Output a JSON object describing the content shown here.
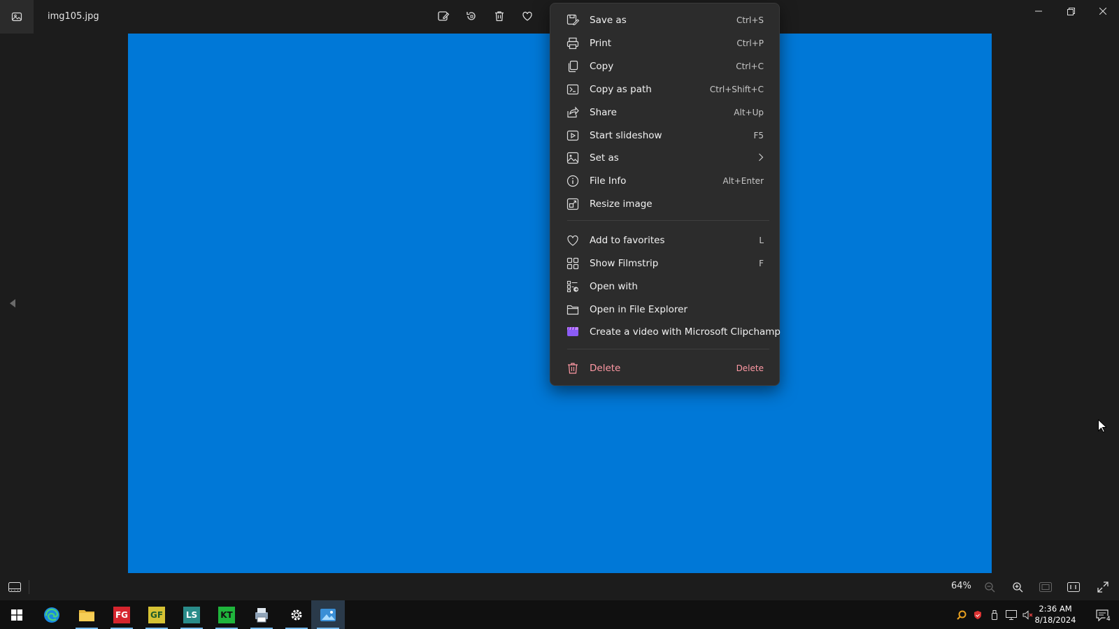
{
  "window": {
    "filename": "img105.jpg",
    "toolbar_icons": [
      "edit-image-icon",
      "rotate-icon",
      "delete-icon",
      "favorite-icon"
    ],
    "controls": [
      "minimize-icon",
      "restore-icon",
      "close-icon"
    ]
  },
  "image": {
    "fill_color": "#0078d7"
  },
  "context_menu": {
    "items": [
      {
        "label": "Save as",
        "shortcut": "Ctrl+S",
        "icon": "save-as-icon"
      },
      {
        "label": "Print",
        "shortcut": "Ctrl+P",
        "icon": "print-icon"
      },
      {
        "label": "Copy",
        "shortcut": "Ctrl+C",
        "icon": "copy-icon"
      },
      {
        "label": "Copy as path",
        "shortcut": "Ctrl+Shift+C",
        "icon": "copy-path-icon"
      },
      {
        "label": "Share",
        "shortcut": "Alt+Up",
        "icon": "share-icon"
      },
      {
        "label": "Start slideshow",
        "shortcut": "F5",
        "icon": "slideshow-icon"
      },
      {
        "label": "Set as",
        "shortcut": "",
        "icon": "set-as-icon",
        "submenu": true
      },
      {
        "label": "File Info",
        "shortcut": "Alt+Enter",
        "icon": "info-icon"
      },
      {
        "label": "Resize image",
        "shortcut": "",
        "icon": "resize-icon"
      },
      {
        "label": "Add to favorites",
        "shortcut": "L",
        "icon": "heart-icon"
      },
      {
        "label": "Show Filmstrip",
        "shortcut": "F",
        "icon": "filmstrip-icon"
      },
      {
        "label": "Open with",
        "shortcut": "",
        "icon": "open-with-icon"
      },
      {
        "label": "Open in File Explorer",
        "shortcut": "",
        "icon": "folder-icon"
      },
      {
        "label": "Create a video with Microsoft Clipchamp",
        "shortcut": "",
        "icon": "clipchamp-icon"
      },
      {
        "label": "Delete",
        "shortcut": "Delete",
        "icon": "trash-icon",
        "danger": true
      }
    ]
  },
  "statusbar": {
    "zoom": "64%",
    "buttons": [
      "zoom-out-icon",
      "zoom-in-icon",
      "fit-to-window-icon",
      "actual-size-icon",
      "fullscreen-icon"
    ]
  },
  "taskbar": {
    "apps": [
      "start-icon",
      "edge-icon",
      "file-explorer-icon",
      "app-fg-icon",
      "app-gf-icon",
      "app-ls-icon",
      "app-kt-icon",
      "app-printer-icon",
      "settings-icon",
      "photos-icon"
    ],
    "time": "2:36 AM",
    "date": "8/18/2024",
    "notification_count": "4"
  },
  "colors": {
    "accent": "#0078d7",
    "menu_bg": "#2c2c2c",
    "danger": "#ff99a4",
    "taskbar_bg": "#101010"
  }
}
